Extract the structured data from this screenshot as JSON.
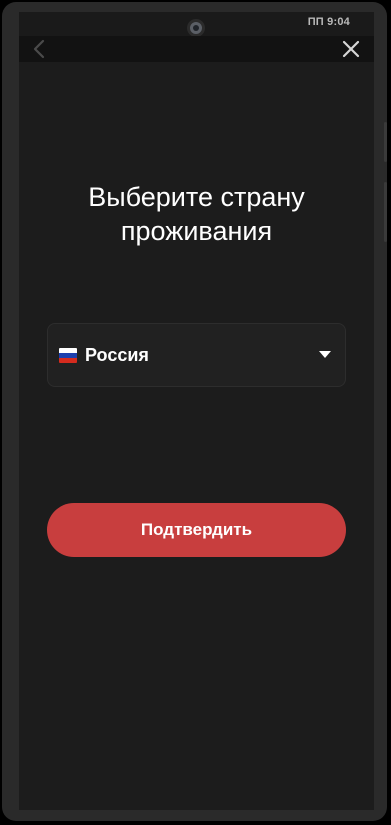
{
  "status_bar": {
    "time": "ПП 9:04"
  },
  "nav": {
    "back_icon": "chevron-left-icon",
    "close_icon": "close-icon"
  },
  "page": {
    "title_line1": "Выберите страну",
    "title_line2": "проживания"
  },
  "country_select": {
    "value": "Россия",
    "flag_icon": "russia-flag-icon",
    "arrow_icon": "caret-down-icon",
    "flag_colors": [
      "#ffffff",
      "#1c3fae",
      "#d52b1e"
    ]
  },
  "actions": {
    "confirm_label": "Подтвердить"
  },
  "colors": {
    "background": "#1c1c1c",
    "accent": "#c83e3e",
    "select_bg": "#212121",
    "text": "#ffffff"
  }
}
